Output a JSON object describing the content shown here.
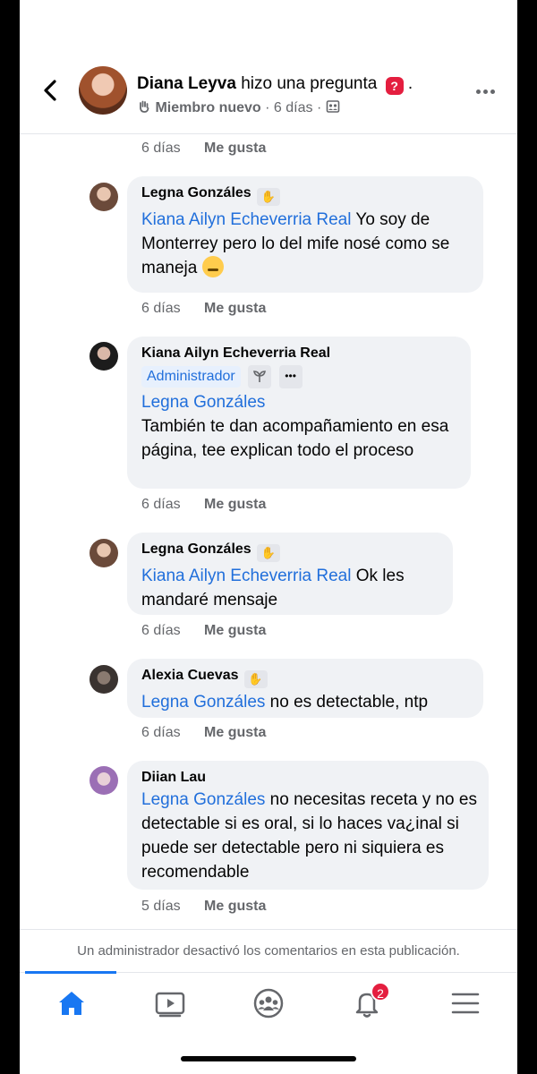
{
  "header": {
    "author": "Diana Leyva",
    "action_text": "hizo una pregunta",
    "question_badge": "?",
    "trailing_dot": ".",
    "subtitle_role": "Miembro nuevo",
    "subtitle_time": "6 días",
    "subtitle_sep": "·",
    "icons": [
      "back-arrow-icon",
      "question-icon",
      "wave-hand-icon",
      "group-privacy-icon",
      "more-icon"
    ]
  },
  "top_actions": {
    "time": "6 días",
    "like": "Me gusta"
  },
  "comments": [
    {
      "author": "Legna Gonzáles",
      "mention": "Kiana Ailyn Echeverria Real",
      "text": " Yo soy de Monterrey pero lo del mife nosé como se maneja",
      "time": "6 días",
      "like": "Me gusta"
    },
    {
      "author": "Kiana Ailyn Echeverria Real",
      "badge": "Administrador",
      "badge_more": "•••",
      "mention": "Legna Gonzáles",
      "text": "También te dan acompañamiento en esa página, tee explican todo el proceso",
      "time": "6 días",
      "like": "Me gusta"
    },
    {
      "author": "Legna Gonzáles",
      "mention": "Kiana Ailyn Echeverria Real",
      "text": " Ok les mandaré mensaje",
      "time": "6 días",
      "like": "Me gusta"
    },
    {
      "author": "Alexia Cuevas",
      "mention": "Legna Gonzáles",
      "text": " no es detectable, ntp",
      "time": "6 días",
      "like": "Me gusta"
    },
    {
      "author": "Diian Lau",
      "mention": "Legna Gonzáles",
      "text": " no necesitas receta y no es detectable si es oral, si lo haces va¿inal si puede ser detectable pero ni siquiera es recomendable",
      "time": "5 días",
      "like": "Me gusta"
    }
  ],
  "notice": "Un administrador desactivó los comentarios en esta publicación.",
  "tabbar": {
    "tabs": [
      "home-icon",
      "video-icon",
      "groups-icon",
      "notifications-icon",
      "menu-icon"
    ],
    "notification_count": "2"
  },
  "colors": {
    "accent": "#1877f2",
    "mention": "#216fdb",
    "bubble": "#f0f2f5",
    "badge_red": "#e41e3f"
  }
}
